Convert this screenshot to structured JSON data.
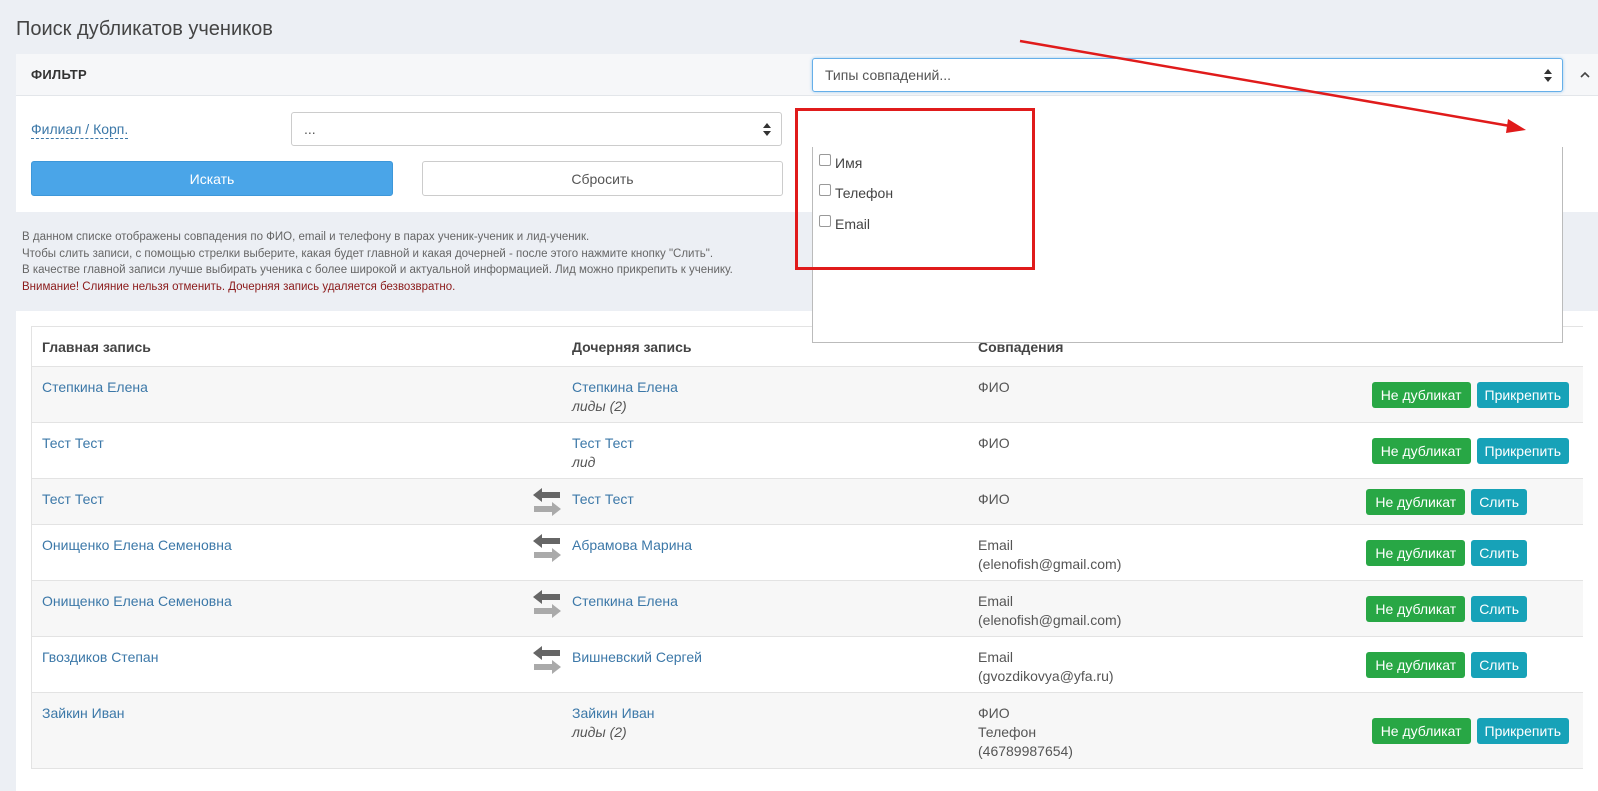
{
  "page": {
    "title": "Поиск дубликатов учеников"
  },
  "filter": {
    "title": "ФИЛЬТР",
    "branch_label": "Филиал / Корп.",
    "branch_value": "...",
    "match_placeholder": "Типы совпадений...",
    "search_button": "Искать",
    "reset_button": "Сбросить",
    "match_options": [
      {
        "label": "Имя",
        "checked": false
      },
      {
        "label": "Телефон",
        "checked": false
      },
      {
        "label": "Email",
        "checked": false
      }
    ]
  },
  "info": {
    "line1": "В данном списке отображены совпадения по ФИО, email и телефону в парах ученик-ученик и лид-ученик.",
    "line2": "Чтобы слить записи, с помощью стрелки выберите, какая будет главной и какая дочерней - после этого нажмите кнопку \"Слить\".",
    "line3": "В качестве главной записи лучше выбирать ученика с более широкой и актуальной информацией. Лид можно прикрепить к ученику.",
    "warning": "Внимание! Слияние нельзя отменить. Дочерняя запись удаляется безвозвратно."
  },
  "table": {
    "headers": {
      "main": "Главная запись",
      "child": "Дочерняя запись",
      "match": "Совпадения"
    },
    "rows": [
      {
        "main": "Степкина Елена",
        "child": "Степкина Елена",
        "child_sub": "лиды (2)",
        "match1": "ФИО",
        "match2": "",
        "match3": "",
        "btn1": "Не дубликат",
        "btn2": "Прикрепить"
      },
      {
        "main": "Тест Тест",
        "child": "Тест Тест",
        "child_sub": "лид",
        "match1": "ФИО",
        "match2": "",
        "match3": "",
        "btn1": "Не дубликат",
        "btn2": "Прикрепить"
      },
      {
        "main": "Тест Тест",
        "child": "Тест Тест",
        "child_sub": "",
        "match1": "ФИО",
        "match2": "",
        "match3": "",
        "btn1": "Не дубликат",
        "btn2": "Слить"
      },
      {
        "main": "Онищенко Елена Семеновна",
        "child": "Абрамова Марина",
        "child_sub": "",
        "match1": "Email",
        "match2": "(elenofish@gmail.com)",
        "match3": "",
        "btn1": "Не дубликат",
        "btn2": "Слить"
      },
      {
        "main": "Онищенко Елена Семеновна",
        "child": "Степкина Елена",
        "child_sub": "",
        "match1": "Email",
        "match2": "(elenofish@gmail.com)",
        "match3": "",
        "btn1": "Не дубликат",
        "btn2": "Слить"
      },
      {
        "main": "Гвоздиков Степан",
        "child": "Вишневский Сергей",
        "child_sub": "",
        "match1": "Email",
        "match2": "(gvozdikovya@yfa.ru)",
        "match3": "",
        "btn1": "Не дубликат",
        "btn2": "Слить"
      },
      {
        "main": "Зайкин Иван",
        "child": "Зайкин Иван",
        "child_sub": "лиды (2)",
        "match1": "ФИО",
        "match2": "Телефон",
        "match3": "(46789987654)",
        "btn1": "Не дубликат",
        "btn2": "Прикрепить"
      }
    ]
  },
  "icons": {
    "swap": "swap-arrows-icon",
    "collapse": "chevron-up-icon",
    "sort": "sort-icon"
  },
  "colors": {
    "primary": "#4aa5e8",
    "success": "#28a745",
    "info": "#17a2b8",
    "link": "#3c78a8",
    "annotation": "#e01b1b"
  }
}
